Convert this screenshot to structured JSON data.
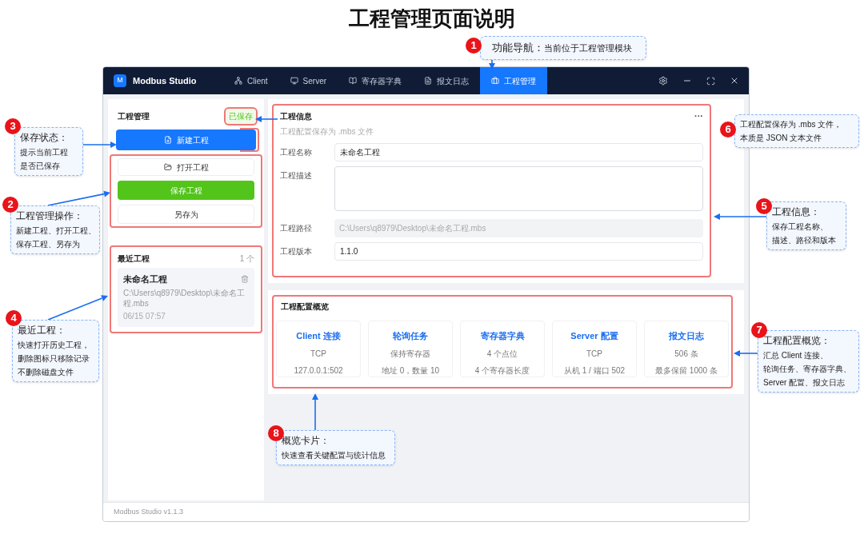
{
  "title": "工程管理页面说明",
  "app": {
    "logo_letter": "M",
    "name": "Modbus Studio",
    "tabs": [
      {
        "label": "Client",
        "selected": false
      },
      {
        "label": "Server",
        "selected": false
      },
      {
        "label": "寄存器字典",
        "selected": false
      },
      {
        "label": "报文日志",
        "selected": false
      },
      {
        "label": "工程管理",
        "selected": true
      }
    ],
    "sidebar": {
      "title": "工程管理",
      "save_status": "已保存",
      "buttons": [
        {
          "label": "新建工程",
          "kind": "primary"
        },
        {
          "label": "打开工程",
          "kind": "default"
        },
        {
          "label": "保存工程",
          "kind": "success"
        },
        {
          "label": "另存为",
          "kind": "plain"
        }
      ],
      "recent": {
        "title": "最近工程",
        "count": "1 个",
        "items": [
          {
            "name": "未命名工程",
            "path": "C:\\Users\\q8979\\Desktop\\未命名工程.mbs",
            "time": "06/15 07:57"
          }
        ]
      }
    },
    "project_info": {
      "title": "工程信息",
      "subtitle": "工程配置保存为 .mbs 文件",
      "more": "···",
      "fields": [
        {
          "label": "工程名称",
          "kind": "input",
          "value": "未命名工程"
        },
        {
          "label": "工程描述",
          "kind": "textarea"
        },
        {
          "label": "工程路径",
          "kind": "readonly",
          "value": "C:\\Users\\q8979\\Desktop\\未命名工程.mbs"
        },
        {
          "label": "工程版本",
          "kind": "input",
          "value": "1.1.0"
        }
      ]
    },
    "overview": {
      "title": "工程配置概览",
      "cards": [
        {
          "title": "Client 连接",
          "line_1": "TCP",
          "line_2": "127.0.0.1:502"
        },
        {
          "title": "轮询任务",
          "line_1": "保持寄存器",
          "line_2": "地址 0，数量 10"
        },
        {
          "title": "寄存器字典",
          "line_1": "4 个点位",
          "line_2": "4 个寄存器长度"
        },
        {
          "title": "Server 配置",
          "line_1": "TCP",
          "line_2": "从机 1 / 端口 502"
        },
        {
          "title": "报文日志",
          "line_1": "506 条",
          "line_2": "最多保留 1000 条"
        }
      ]
    },
    "status_bar": "Modbus Studio v1.1.3"
  },
  "annotations": [
    {
      "number": "1",
      "title": "功能导航：",
      "lines": [
        "当前位于工程管理模块"
      ]
    },
    {
      "number": "3",
      "title": "保存状态：",
      "lines": [
        "提示当前工程",
        "是否已保存"
      ]
    },
    {
      "number": "2",
      "title": "工程管理操作：",
      "lines": [
        "新建工程、打开工程、",
        "保存工程、另存为"
      ]
    },
    {
      "number": "4",
      "title": "最近工程：",
      "lines": [
        "快速打开历史工程，",
        "删除图标只移除记录",
        "不删除磁盘文件"
      ]
    },
    {
      "number": "6",
      "lines": [
        "工程配置保存为 .mbs 文件，",
        "本质是 JSON 文本文件"
      ]
    },
    {
      "number": "5",
      "title": "工程信息：",
      "lines": [
        "保存工程名称、",
        "描述、路径和版本"
      ]
    },
    {
      "number": "7",
      "title": "工程配置概览：",
      "lines": [
        "汇总 Client 连接、",
        "轮询任务、寄存器字典、",
        "Server 配置、报文日志"
      ]
    },
    {
      "number": "8",
      "title": "概览卡片：",
      "lines": [
        "快速查看关键配置与统计信息"
      ]
    }
  ]
}
